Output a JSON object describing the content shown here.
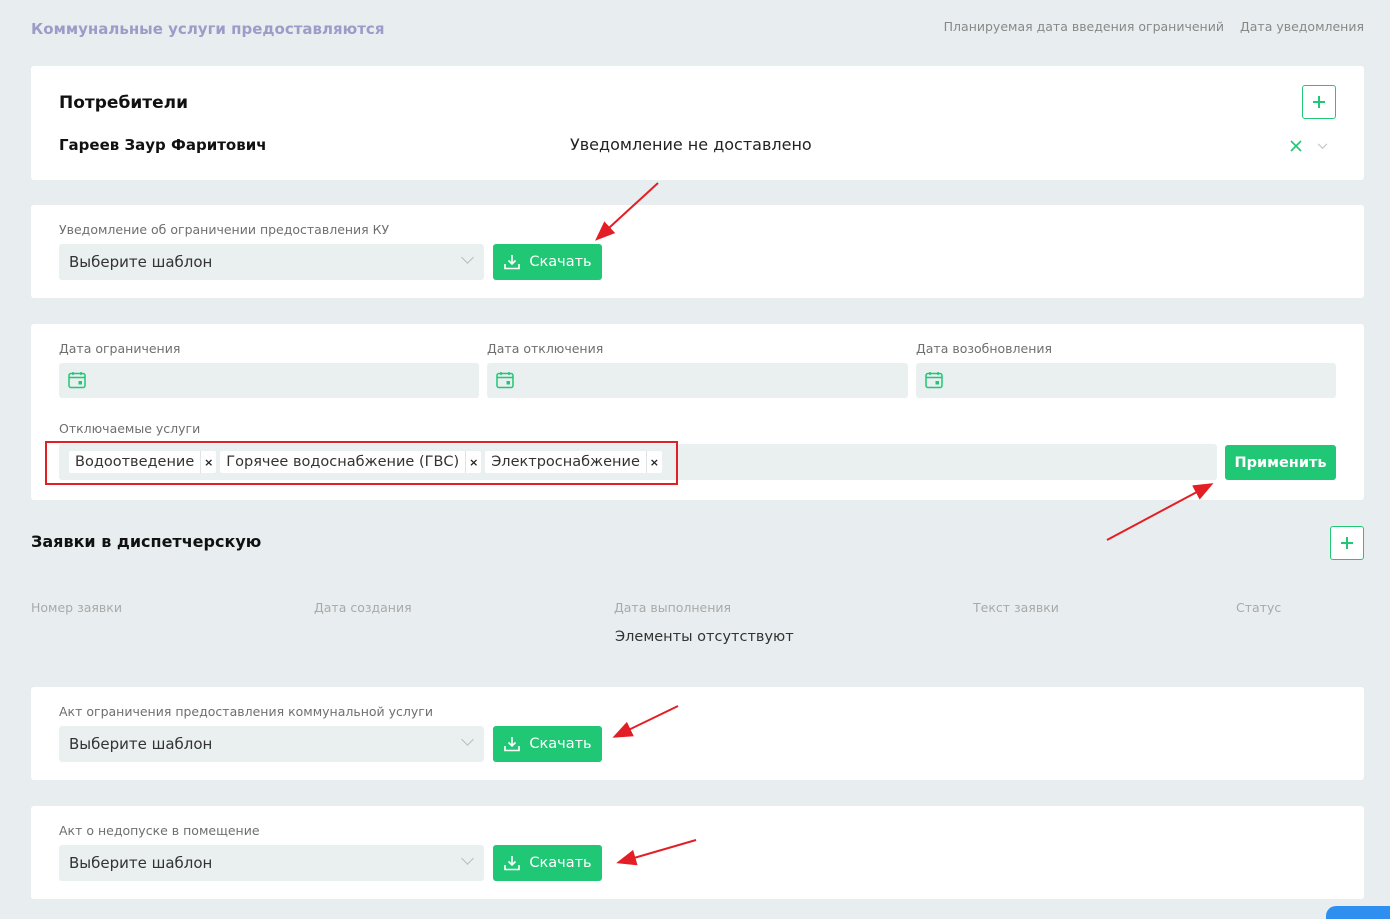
{
  "header": {
    "title": "Коммунальные услуги предоставляются",
    "right_labels": [
      "Планируемая дата введения ограничений",
      "Дата уведомления"
    ]
  },
  "consumers": {
    "title": "Потребители",
    "name": "Гареев Заур Фаритович",
    "status": "Уведомление не доставлено",
    "add_icon": "plus-icon",
    "remove_icon": "close-icon",
    "expand_icon": "chevron-down-icon"
  },
  "notice": {
    "label": "Уведомление об ограничении предоставления КУ",
    "select_placeholder": "Выберите шаблон",
    "download_label": "Скачать"
  },
  "dates": {
    "restriction_label": "Дата ограничения",
    "disconnection_label": "Дата отключения",
    "resumption_label": "Дата возобновления"
  },
  "services": {
    "label": "Отключаемые услуги",
    "tags": [
      "Водоотведение",
      "Горячее водоснабжение (ГВС)",
      "Электроснабжение"
    ],
    "tag_remove": "×",
    "apply_label": "Применить"
  },
  "dispatch": {
    "title": "Заявки в диспетчерскую",
    "columns": [
      "Номер заявки",
      "Дата создания",
      "Дата выполнения",
      "Текст заявки",
      "Статус"
    ],
    "empty_text": "Элементы отсутствуют"
  },
  "act_restriction": {
    "label": "Акт ограничения предоставления коммунальной услуги",
    "select_placeholder": "Выберите шаблон",
    "download_label": "Скачать"
  },
  "act_access": {
    "label": "Акт о недопуске в помещение",
    "select_placeholder": "Выберите шаблон",
    "download_label": "Скачать"
  },
  "colors": {
    "accent": "#20c775",
    "highlight": "#e31e24",
    "background": "#e8eeef"
  }
}
